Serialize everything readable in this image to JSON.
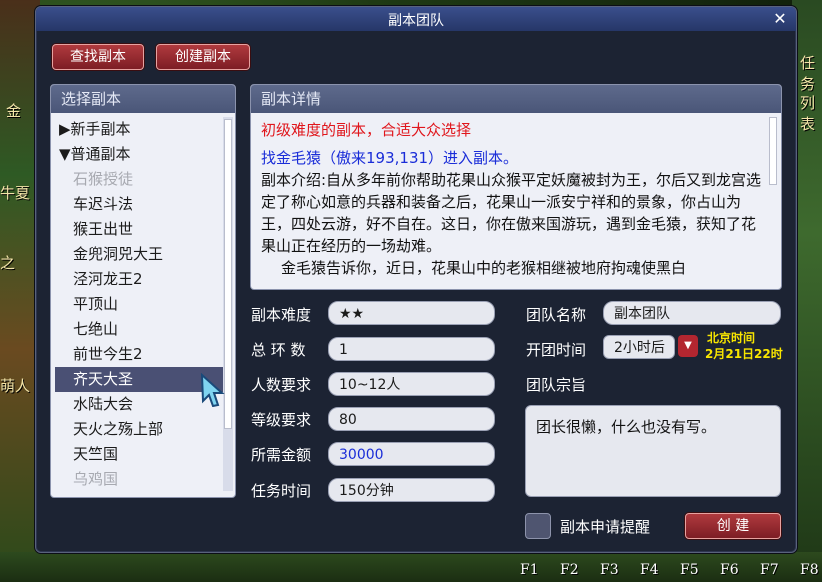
{
  "background": {
    "left_texts": [
      "金",
      "牛夏",
      "之",
      "萌人"
    ],
    "right_texts": [
      "任务",
      "列表"
    ],
    "hotkeys": [
      "F1",
      "F2",
      "F3",
      "F4",
      "F5",
      "F6",
      "F7",
      "F8"
    ]
  },
  "window": {
    "title": "副本团队",
    "close_icon": "✕"
  },
  "toolbar": {
    "find_label": "查找副本",
    "create_label": "创建副本"
  },
  "list": {
    "header": "选择副本",
    "items": [
      {
        "label": "新手副本",
        "type": "group-collapsed",
        "arrow": "▶"
      },
      {
        "label": "普通副本",
        "type": "group-expanded",
        "arrow": "▼"
      },
      {
        "label": "石猴授徒",
        "type": "disabled"
      },
      {
        "label": "车迟斗法",
        "type": "normal"
      },
      {
        "label": "猴王出世",
        "type": "normal"
      },
      {
        "label": "金兜洞兕大王",
        "type": "normal"
      },
      {
        "label": "泾河龙王2",
        "type": "normal"
      },
      {
        "label": "平顶山",
        "type": "normal"
      },
      {
        "label": "七绝山",
        "type": "normal"
      },
      {
        "label": "前世今生2",
        "type": "normal"
      },
      {
        "label": "齐天大圣",
        "type": "selected"
      },
      {
        "label": "水陆大会",
        "type": "normal"
      },
      {
        "label": "天火之殇上部",
        "type": "normal"
      },
      {
        "label": "天竺国",
        "type": "normal"
      },
      {
        "label": "乌鸡国",
        "type": "disabled"
      }
    ]
  },
  "detail": {
    "header": "副本详情",
    "difficulty_line": "初级难度的副本，合适大众选择",
    "location_line": "找金毛猿（傲来193,131）进入副本。",
    "intro": "副本介绍:自从多年前你帮助花果山众猴平定妖魔被封为王，尔后又到龙宫选定了称心如意的兵器和装备之后，花果山一派安宁祥和的景象，你占山为王，四处云游，好不自在。这日，你在傲来国游玩，遇到金毛猿，获知了花果山正在经历的一场劫难。",
    "intro2": "金毛猿告诉你，近日，花果山中的老猴相继被地府拘魂使黑白"
  },
  "form": {
    "difficulty_label": "副本难度",
    "difficulty_value": "★★",
    "rounds_label": "总 环 数",
    "rounds_value": "1",
    "people_label": "人数要求",
    "people_value": "10~12人",
    "level_label": "等级要求",
    "level_value": "80",
    "money_label": "所需金额",
    "money_value": "30000",
    "time_label": "任务时间",
    "time_value": "150分钟",
    "team_name_label": "团队名称",
    "team_name_value": "副本团队",
    "open_time_label": "开团时间",
    "open_time_value": "2小时后",
    "beijing_time_label": "北京时间",
    "beijing_time_value": "2月21日22时",
    "motto_label": "团队宗旨",
    "motto_value": "团长很懒，什么也没有写。",
    "reminder_label": "副本申请提醒",
    "create_button": "创 建"
  },
  "colors": {
    "accent_red": "#b03a3e",
    "selected_row": "#4a5074",
    "money_blue": "#1a2dd8",
    "warning_red": "#e0161c",
    "time_yellow": "#f8e500"
  }
}
